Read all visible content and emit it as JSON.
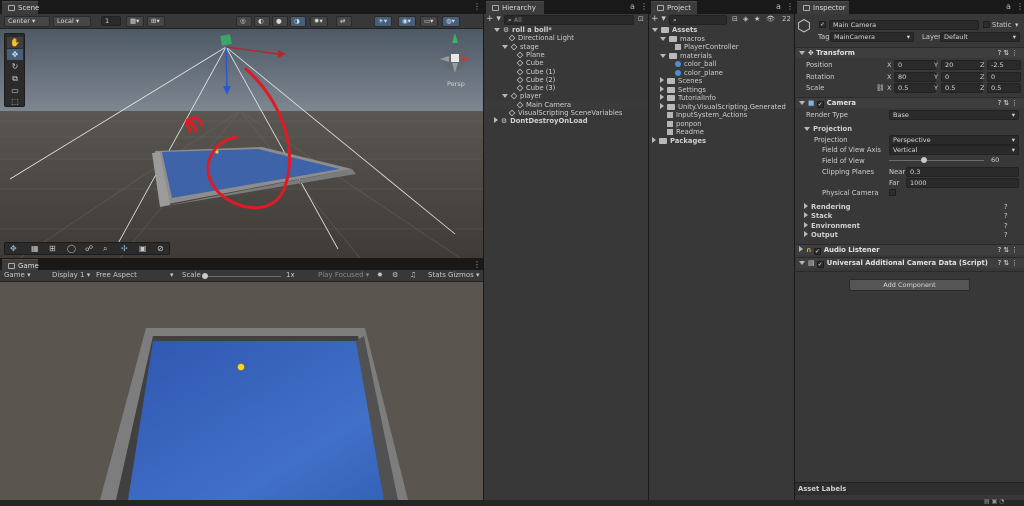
{
  "scene": {
    "tab": "Scene",
    "pivot": "Center",
    "space": "Local",
    "snap": "1",
    "persp_label": "Persp",
    "tools": [
      "hand-icon",
      "move-icon",
      "rotate-icon",
      "scale-icon",
      "rect-icon",
      "transform-icon"
    ]
  },
  "game": {
    "tab": "Game",
    "view": "Game",
    "display": "Display 1",
    "aspect": "Free Aspect",
    "scale_label": "Scale",
    "scale_value": "1x",
    "play_mode": "Play Focused",
    "stats": "Stats",
    "gizmos": "Gizmos"
  },
  "hierarchy": {
    "tab": "Hierarchy",
    "search_placeholder": "All",
    "items": [
      {
        "label": "roll a boll*",
        "depth": 0,
        "kind": "scene",
        "arrow": "down"
      },
      {
        "label": "Directional Light",
        "depth": 1,
        "kind": "obj",
        "arrow": ""
      },
      {
        "label": "stage",
        "depth": 1,
        "kind": "obj",
        "arrow": "down"
      },
      {
        "label": "Plane",
        "depth": 2,
        "kind": "obj",
        "arrow": ""
      },
      {
        "label": "Cube",
        "depth": 2,
        "kind": "obj",
        "arrow": ""
      },
      {
        "label": "Cube (1)",
        "depth": 2,
        "kind": "obj",
        "arrow": ""
      },
      {
        "label": "Cube (2)",
        "depth": 2,
        "kind": "obj",
        "arrow": ""
      },
      {
        "label": "Cube (3)",
        "depth": 2,
        "kind": "obj",
        "arrow": ""
      },
      {
        "label": "player",
        "depth": 1,
        "kind": "obj",
        "arrow": "down"
      },
      {
        "label": "Main Camera",
        "depth": 2,
        "kind": "obj",
        "arrow": "",
        "selected": true
      },
      {
        "label": "VisualScripting SceneVariables",
        "depth": 1,
        "kind": "obj",
        "arrow": ""
      },
      {
        "label": "DontDestroyOnLoad",
        "depth": 0,
        "kind": "scene",
        "arrow": "right"
      }
    ]
  },
  "project": {
    "tab": "Project",
    "count": "22",
    "items": [
      {
        "label": "Assets",
        "depth": 0,
        "kind": "folder",
        "arrow": "down",
        "bold": true
      },
      {
        "label": "macros",
        "depth": 1,
        "kind": "folder",
        "arrow": "down"
      },
      {
        "label": "PlayerController",
        "depth": 2,
        "kind": "asset",
        "arrow": ""
      },
      {
        "label": "materials",
        "depth": 1,
        "kind": "folder",
        "arrow": "down"
      },
      {
        "label": "color_ball",
        "depth": 2,
        "kind": "mat",
        "arrow": ""
      },
      {
        "label": "color_plane",
        "depth": 2,
        "kind": "mat",
        "arrow": ""
      },
      {
        "label": "Scenes",
        "depth": 1,
        "kind": "folder",
        "arrow": "right"
      },
      {
        "label": "Settings",
        "depth": 1,
        "kind": "folder",
        "arrow": "right"
      },
      {
        "label": "TutorialInfo",
        "depth": 1,
        "kind": "folder",
        "arrow": "right"
      },
      {
        "label": "Unity.VisualScripting.Generated",
        "depth": 1,
        "kind": "folder",
        "arrow": "right"
      },
      {
        "label": "InputSystem_Actions",
        "depth": 1,
        "kind": "asset",
        "arrow": ""
      },
      {
        "label": "ponpon",
        "depth": 1,
        "kind": "asset",
        "arrow": ""
      },
      {
        "label": "Readme",
        "depth": 1,
        "kind": "asset",
        "arrow": ""
      },
      {
        "label": "Packages",
        "depth": 0,
        "kind": "folder",
        "arrow": "right",
        "bold": true
      }
    ]
  },
  "inspector": {
    "tab": "Inspector",
    "name": "Main Camera",
    "static": "Static",
    "tag_label": "Tag",
    "tag": "MainCamera",
    "layer_label": "Layer",
    "layer": "Default",
    "transform": {
      "title": "Transform",
      "rows": [
        {
          "label": "Position",
          "x": "0",
          "y": "20",
          "z": "-2.5"
        },
        {
          "label": "Rotation",
          "x": "80",
          "y": "0",
          "z": "0"
        },
        {
          "label": "Scale",
          "x": "0.5",
          "y": "0.5",
          "z": "0.5"
        }
      ]
    },
    "camera": {
      "title": "Camera",
      "render_type_label": "Render Type",
      "render_type": "Base",
      "projection_header": "Projection",
      "projection_label": "Projection",
      "projection": "Perspective",
      "fov_axis_label": "Field of View Axis",
      "fov_axis": "Vertical",
      "fov_label": "Field of View",
      "fov": "60",
      "clip_label": "Clipping Planes",
      "near_label": "Near",
      "near": "0.3",
      "far_label": "Far",
      "far": "1000",
      "physical_label": "Physical Camera",
      "rendering": "Rendering",
      "stack": "Stack",
      "environment": "Environment",
      "output": "Output"
    },
    "audio": "Audio Listener",
    "uacd": "Universal Additional Camera Data (Script)",
    "add_component": "Add Component",
    "asset_labels": "Asset Labels"
  },
  "colors": {
    "accent": "#2c5d87",
    "annotation": "#e01b24",
    "plane": "#3a5ea8"
  }
}
